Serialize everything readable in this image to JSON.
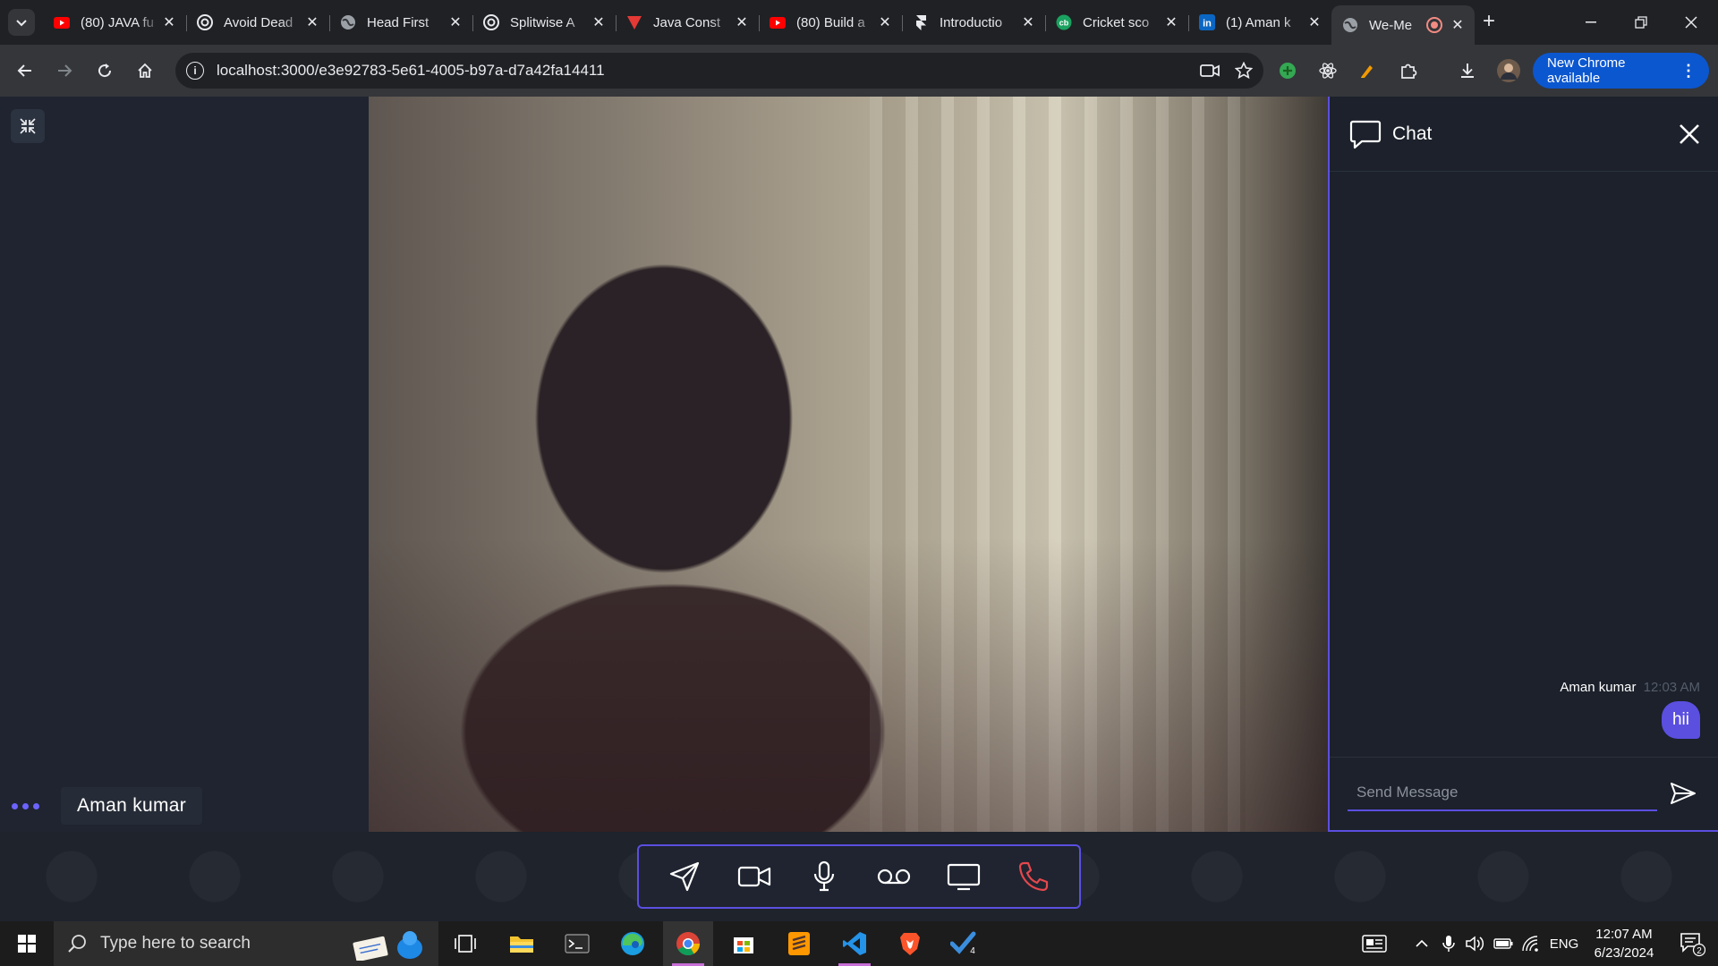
{
  "browser": {
    "tabs": [
      {
        "title": "(80) JAVA fu",
        "favicon": "youtube-icon"
      },
      {
        "title": "Avoid Dead",
        "favicon": "openai-icon"
      },
      {
        "title": "Head First",
        "favicon": "globe-icon"
      },
      {
        "title": "Splitwise A",
        "favicon": "openai-icon"
      },
      {
        "title": "Java Const",
        "favicon": "vercel-icon"
      },
      {
        "title": "(80) Build a",
        "favicon": "youtube-icon"
      },
      {
        "title": "Introductio",
        "favicon": "framer-icon"
      },
      {
        "title": "Cricket sco",
        "favicon": "cricbuzz-icon"
      },
      {
        "title": "(1) Aman k",
        "favicon": "linkedin-icon"
      },
      {
        "title": "We-Me",
        "favicon": "globe-icon",
        "active": true,
        "recording": true
      }
    ],
    "address": "localhost:3000/e3e92783-5e61-4005-b97a-d7a42fa14411",
    "update_label": "New Chrome available"
  },
  "meeting": {
    "participant_name": "Aman kumar",
    "chat": {
      "title": "Chat",
      "messages": [
        {
          "sender": "Aman kumar",
          "time": "12:03 AM",
          "text": "hii"
        }
      ],
      "input_placeholder": "Send Message"
    },
    "controls": [
      "send-icon",
      "video-camera-icon",
      "microphone-icon",
      "voicemail-icon",
      "screen-share-icon",
      "end-call-icon"
    ]
  },
  "taskbar": {
    "search_placeholder": "Type here to search",
    "language": "ENG",
    "time": "12:07 AM",
    "date": "6/23/2024",
    "notification_count": "2",
    "todo_badge": "4"
  },
  "colors": {
    "accent": "#5b4fe0",
    "end_call": "#e5484d",
    "chrome_update": "#0b57d0"
  }
}
